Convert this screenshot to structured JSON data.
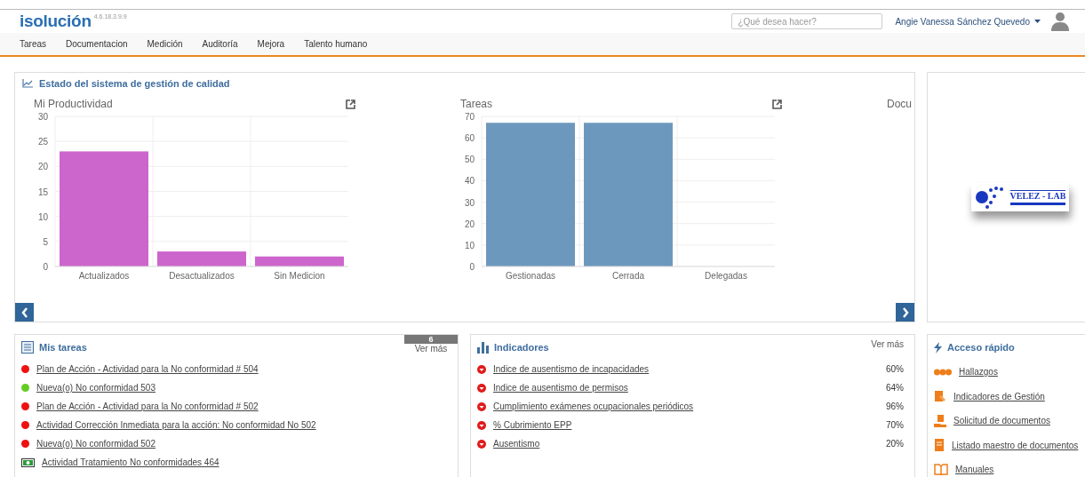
{
  "header": {
    "logo": "isolución",
    "version": "4.6.18.3.9.9",
    "search": {
      "placeholder": "¿Qué desea hacer?"
    },
    "user": "Angie Vanessa Sánchez Quevedo"
  },
  "nav": [
    "Tareas",
    "Documentacion",
    "Medición",
    "Auditoría",
    "Mejora",
    "Talento humano"
  ],
  "quality_panel": {
    "title": "Estado del sistema de gestión de calidad",
    "charts": [
      {
        "title": "Mi Productividad",
        "chart_data": {
          "type": "bar",
          "categories": [
            "Actualizados",
            "Desactualizados",
            "Sin Medicion"
          ],
          "series": [
            {
              "color": "#cc66cc",
              "values": [
                23,
                3,
                2
              ]
            }
          ],
          "grid": true,
          "ylim": [
            0,
            30
          ],
          "yticks": [
            0,
            5,
            10,
            15,
            20,
            25,
            30
          ]
        }
      },
      {
        "title": "Tareas",
        "chart_data": {
          "type": "bar",
          "categories": [
            "Gestionadas",
            "Cerrada",
            "Delegadas"
          ],
          "series": [
            {
              "color": "#6d98bd",
              "values": [
                67,
                67,
                0
              ]
            }
          ],
          "grid": true,
          "ylim": [
            0,
            70
          ],
          "yticks": [
            0,
            10,
            20,
            30,
            40,
            50,
            60,
            70
          ]
        }
      },
      {
        "title": "Docu"
      }
    ]
  },
  "company_logo": {
    "name": "VELEZ - LAB"
  },
  "tasks": {
    "title": "Mis tareas",
    "count": "6",
    "more": "Ver más",
    "items": [
      {
        "kind": "dot",
        "color": "#ee1111",
        "text": "Plan de Acción - Actividad para la No conformidad # 504"
      },
      {
        "kind": "dot",
        "color": "#66cc22",
        "text": "Nueva(o) No conformidad 503"
      },
      {
        "kind": "dot",
        "color": "#ee1111",
        "text": "Plan de Acción - Actividad para la No conformidad # 502"
      },
      {
        "kind": "dot",
        "color": "#ee1111",
        "text": "Actividad Corrección Inmediata para la acción: No conformidad No 502"
      },
      {
        "kind": "dot",
        "color": "#ee1111",
        "text": "Nueva(o) No conformidad 502"
      },
      {
        "kind": "icon",
        "text": "Actividad Tratamiento No conformidades 464"
      }
    ]
  },
  "indicators": {
    "title": "Indicadores",
    "more": "Ver más",
    "items": [
      {
        "text": "Indice de ausentismo de incapacidades",
        "value": "60%"
      },
      {
        "text": "Indice de ausentismo de permisos",
        "value": "64%"
      },
      {
        "text": "Cumplimiento exámenes ocupacionales periódicos",
        "value": "96%"
      },
      {
        "text": "% Cubrimiento EPP",
        "value": "70%"
      },
      {
        "text": "Ausentismo",
        "value": "20%"
      }
    ]
  },
  "quick_access": {
    "title": "Acceso rápido",
    "items": [
      "Hallazgos",
      "Indicadores de Gestión",
      "Solicitud de documentos",
      "Listado maestro de documentos",
      "Manuales"
    ]
  }
}
